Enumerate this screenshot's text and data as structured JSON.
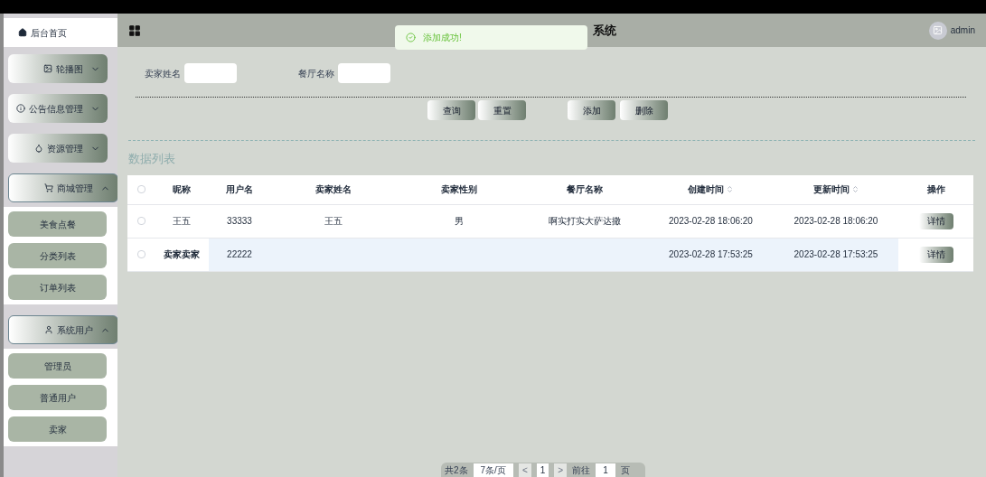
{
  "header": {
    "title": "系统",
    "user": "admin"
  },
  "toast": {
    "message": "添加成功!"
  },
  "sidebar": {
    "items": [
      {
        "label": "后台首页",
        "kind": "link"
      },
      {
        "label": "轮播图",
        "kind": "group",
        "expanded": false
      },
      {
        "label": "公告信息管理",
        "kind": "group",
        "expanded": false
      },
      {
        "label": "资源管理",
        "kind": "group",
        "expanded": false
      },
      {
        "label": "商城管理",
        "kind": "group",
        "expanded": true,
        "children": [
          {
            "label": "美食点餐"
          },
          {
            "label": "分类列表"
          },
          {
            "label": "订单列表"
          }
        ]
      },
      {
        "label": "系统用户",
        "kind": "group",
        "expanded": true,
        "children": [
          {
            "label": "管理员"
          },
          {
            "label": "普通用户"
          },
          {
            "label": "卖家"
          }
        ]
      }
    ]
  },
  "search": {
    "fields": [
      {
        "label": "卖家姓名"
      },
      {
        "label": "餐厅名称"
      }
    ],
    "buttons": [
      "查询",
      "重置"
    ],
    "actions": [
      "添加",
      "删除"
    ]
  },
  "section_title": "数据列表",
  "table": {
    "all_checked": false,
    "columns": [
      {
        "label": "昵称",
        "sortable": false
      },
      {
        "label": "用户名",
        "sortable": false
      },
      {
        "label": "卖家姓名",
        "sortable": false
      },
      {
        "label": "卖家性别",
        "sortable": false
      },
      {
        "label": "餐厅名称",
        "sortable": false
      },
      {
        "label": "创建时间",
        "sortable": true
      },
      {
        "label": "更新时间",
        "sortable": true
      },
      {
        "label": "操作",
        "sortable": false
      }
    ],
    "rows": [
      {
        "checked": false,
        "highlighted": false,
        "cells": [
          "王五",
          "33333",
          "王五",
          "男",
          "啊实打实大萨达撒",
          "2023-02-28 18:06:20",
          "2023-02-28 18:06:20"
        ],
        "action": "详情"
      },
      {
        "checked": false,
        "highlighted": true,
        "cells": [
          "卖家卖家",
          "22222",
          "",
          "",
          "",
          "2023-02-28 17:53:25",
          "2023-02-28 17:53:25"
        ],
        "action": "详情"
      }
    ]
  },
  "pagination": {
    "total": "共2条",
    "page_size": "7条/页",
    "prev": "<",
    "page": "1",
    "next": ">",
    "goto": "前往",
    "goto_value": "1",
    "unit": "页"
  }
}
